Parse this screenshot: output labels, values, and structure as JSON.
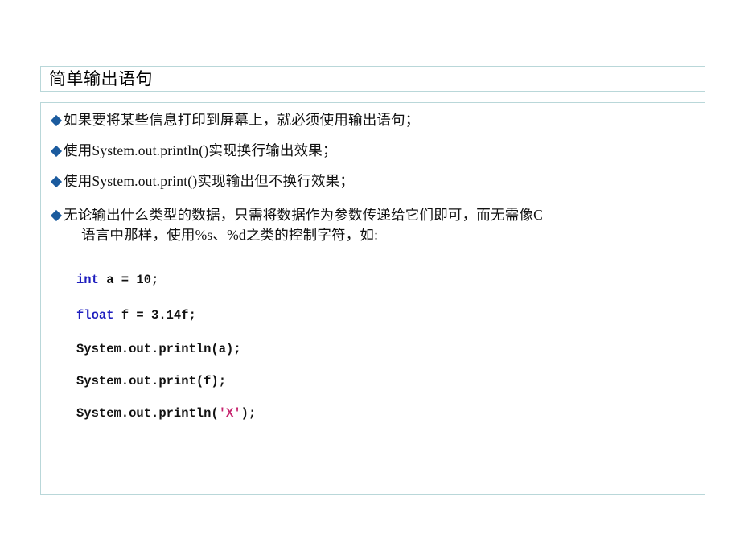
{
  "slide": {
    "title": "简单输出语句",
    "bullets": [
      {
        "marker": "diamond-bullet",
        "text": "如果要将某些信息打印到屏幕上，就必须使用输出语句；"
      },
      {
        "marker": "diamond-bullet",
        "text": "使用System.out.println()实现换行输出效果；"
      },
      {
        "marker": "diamond-bullet",
        "text": "使用System.out.print()实现输出但不换行效果；"
      },
      {
        "marker": "diamond-bullet",
        "text": "无论输出什么类型的数据，只需将数据作为参数传递给它们即可，而无需像C",
        "text_line2": "语言中那样，使用%s、%d之类的控制字符，如:"
      }
    ],
    "code": {
      "line1_keyword": "int",
      "line1_rest": " a = 10;",
      "line2_keyword": "float",
      "line2_rest": " f = 3.14f;",
      "line3": "System.out.println(a);",
      "line4": "System.out.print(f);",
      "line5_prefix": "System.out.println(",
      "line5_literal": "'X'",
      "line5_suffix": ");"
    }
  },
  "colors": {
    "border": "#b9d7d9",
    "bullet": "#1b5b9e",
    "keyword": "#1e1ebe",
    "char_literal": "#c6246e",
    "text": "#111111",
    "background": "#ffffff"
  }
}
